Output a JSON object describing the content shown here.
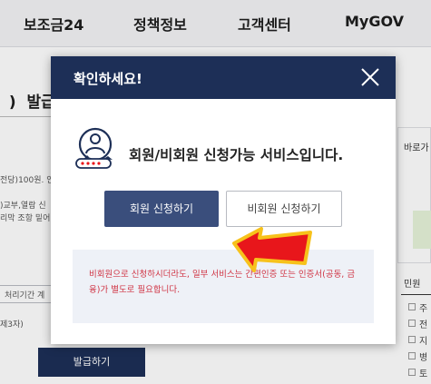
{
  "nav": {
    "items": [
      "보조금24",
      "정책정보",
      "고객센터",
      "MyGOV"
    ]
  },
  "background": {
    "title": "  )  발급",
    "fee_text": "전당)100원. 인",
    "consent_line1": ")교부,열람 신",
    "consent_line2": "리막 조항 밑어",
    "period_select": "처리기간 계",
    "third_party": "제3자)",
    "issue_button": "발급하기",
    "right_title": "바로가",
    "civil_title": "민원",
    "civil_items": [
      "주",
      "전",
      "지",
      "병",
      "토"
    ]
  },
  "modal": {
    "title": "확인하세요!",
    "message": "회원/비회원 신청가능 서비스입니다.",
    "member_button": "회원 신청하기",
    "guest_button": "비회원 신청하기",
    "notice": "비회원으로 신청하시더라도, 일부 서비스는 간편인증 또는 인증서(공동, 금융)가 별도로 필요합니다."
  },
  "colors": {
    "header_navy": "#1d2f57",
    "member_button": "#3a4e7c",
    "notice_red": "#d03545",
    "notice_bg": "#eef1f7",
    "arrow_red": "#e8161b",
    "arrow_yellow": "#f7c21b"
  },
  "icons": {
    "close": "close-icon",
    "service": "user-search-icon",
    "pointer": "arrow-pointer-icon"
  }
}
